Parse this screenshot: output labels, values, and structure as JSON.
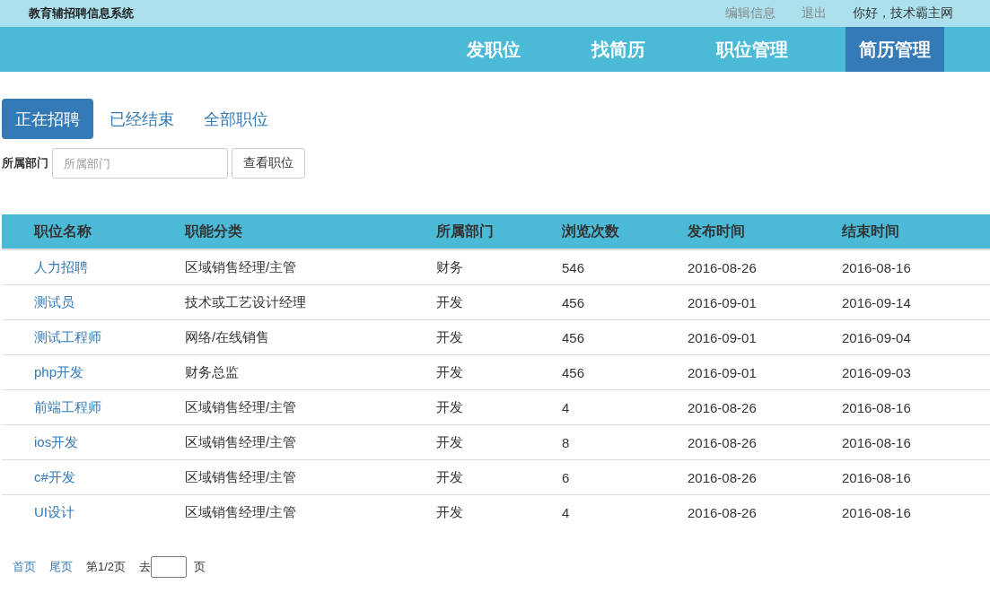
{
  "header": {
    "site_title": "教育辅招聘信息系统",
    "links": [
      "编辑信息",
      "退出"
    ],
    "greeting": "你好，技术霸主网"
  },
  "nav": [
    {
      "label": "发职位",
      "selected": false
    },
    {
      "label": "找简历",
      "selected": false
    },
    {
      "label": "职位管理",
      "selected": false
    },
    {
      "label": "简历管理",
      "selected": true
    }
  ],
  "tabs": [
    {
      "label": "正在招聘",
      "selected": true
    },
    {
      "label": "已经结束",
      "selected": false
    },
    {
      "label": "全部职位",
      "selected": false
    }
  ],
  "filter": {
    "label": "所属部门",
    "placeholder": "所属部门",
    "button": "查看职位"
  },
  "table": {
    "columns": [
      "职位名称",
      "职能分类",
      "所属部门",
      "浏览次数",
      "发布时间",
      "结束时间"
    ],
    "rows": [
      [
        "人力招聘",
        "区域销售经理/主管",
        "财务",
        "546",
        "2016-08-26",
        "2016-08-16"
      ],
      [
        "测试员",
        "技术或工艺设计经理",
        "开发",
        "456",
        "2016-09-01",
        "2016-09-14"
      ],
      [
        "测试工程师",
        "网络/在线销售",
        "开发",
        "456",
        "2016-09-01",
        "2016-09-04"
      ],
      [
        "php开发",
        "财务总监",
        "开发",
        "456",
        "2016-09-01",
        "2016-09-03"
      ],
      [
        "前端工程师",
        "区域销售经理/主管",
        "开发",
        "4",
        "2016-08-26",
        "2016-08-16"
      ],
      [
        "ios开发",
        "区域销售经理/主管",
        "开发",
        "8",
        "2016-08-26",
        "2016-08-16"
      ],
      [
        "c#开发",
        "区域销售经理/主管",
        "开发",
        "6",
        "2016-08-26",
        "2016-08-16"
      ],
      [
        "UI设计",
        "区域销售经理/主管",
        "开发",
        "4",
        "2016-08-26",
        "2016-08-16"
      ]
    ]
  },
  "pagination": {
    "first": "首页",
    "last": "尾页",
    "page_info": "第1/2页",
    "goto_label": "去",
    "page_unit": "页"
  }
}
